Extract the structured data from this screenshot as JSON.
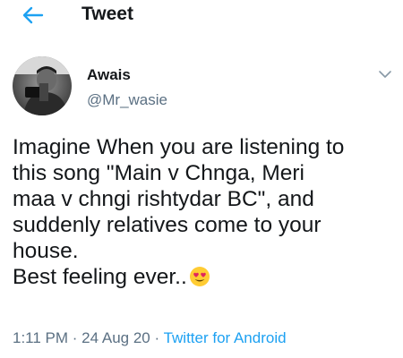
{
  "header": {
    "title": "Tweet"
  },
  "author": {
    "name": "Awais",
    "handle": "@Mr_wasie"
  },
  "tweet": {
    "lines": [
      "Imagine When you are listening to",
      "this song \"Main v Chnga, Meri",
      "maa v chngi rishtydar BC\", and",
      "suddenly relatives come to your",
      "house.",
      "Best feeling ever.."
    ],
    "emoji": "heart-eyes-emoji"
  },
  "meta": {
    "time": "1:11 PM",
    "separator1": " · ",
    "date": "24 Aug 20",
    "separator2": " · ",
    "source": "Twitter for Android"
  },
  "colors": {
    "accent": "#1da1f2",
    "text": "#14171a",
    "secondary": "#5b7083"
  }
}
